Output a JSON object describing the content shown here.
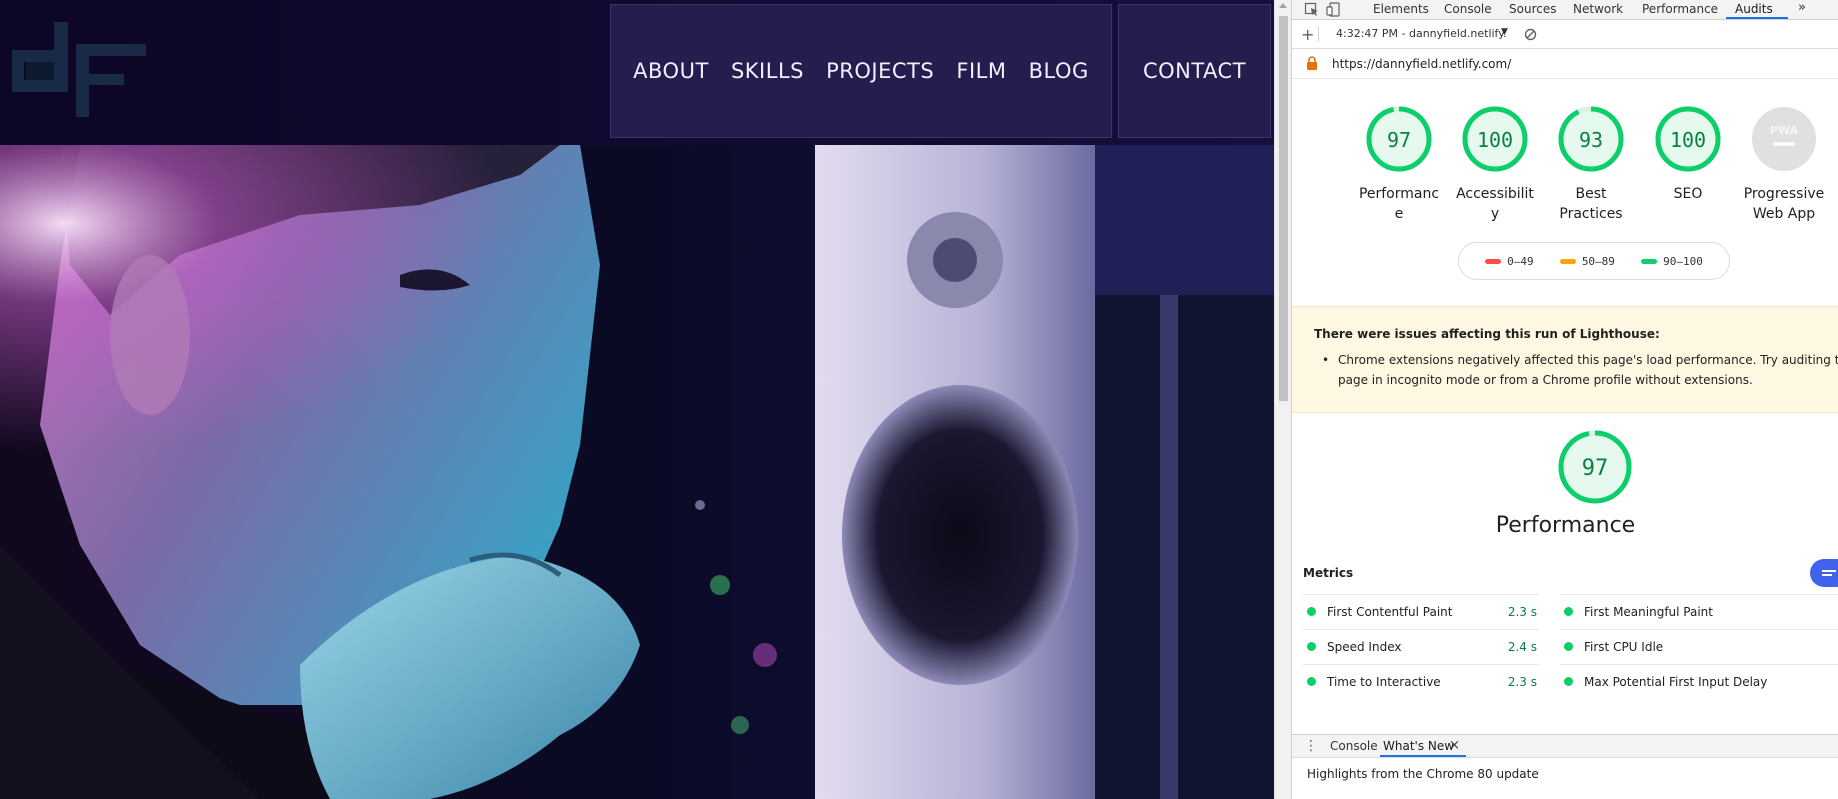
{
  "site": {
    "nav": {
      "about": "ABOUT",
      "skills": "SKILLS",
      "projects": "PROJECTS",
      "film": "FILM",
      "blog": "BLOG",
      "contact": "CONTACT"
    },
    "colors": {
      "header_bg": "#120a32",
      "nav_bg": "#241d4d",
      "nav_text": "#f2f0ff"
    }
  },
  "devtools": {
    "tabs": [
      "Elements",
      "Console",
      "Sources",
      "Network",
      "Performance",
      "Audits"
    ],
    "active_tab": "Audits",
    "more_tabs_icon": "double-chevron-right-icon",
    "report_selector": "4:32:47 PM - dannyfield.netlify.",
    "url": "https://dannyfield.netlify.com/",
    "categories": [
      {
        "score": "97",
        "label": "Performance",
        "value": 97
      },
      {
        "score": "100",
        "label": "Accessibility",
        "value": 100
      },
      {
        "score": "93",
        "label": "Best Practices",
        "value": 93
      },
      {
        "score": "100",
        "label": "SEO",
        "value": 100
      },
      {
        "score": "PWA",
        "label": "Progressive Web App",
        "value": null
      }
    ],
    "legend": [
      {
        "range": "0–49",
        "color": "#ff4e42"
      },
      {
        "range": "50–89",
        "color": "#ffa400"
      },
      {
        "range": "90–100",
        "color": "#0cce6b"
      }
    ],
    "warning": {
      "title": "There were issues affecting this run of Lighthouse:",
      "items": [
        "Chrome extensions negatively affected this page's load performance. Try auditing the page in incognito mode or from a Chrome profile without extensions."
      ]
    },
    "performance": {
      "score": "97",
      "value": 97,
      "title": "Performance",
      "metrics_heading": "Metrics",
      "metrics_left": [
        {
          "name": "First Contentful Paint",
          "value": "2.3 s"
        },
        {
          "name": "Speed Index",
          "value": "2.4 s"
        },
        {
          "name": "Time to Interactive",
          "value": "2.3 s"
        }
      ],
      "metrics_right": [
        {
          "name": "First Meaningful Paint"
        },
        {
          "name": "First CPU Idle"
        },
        {
          "name": "Max Potential First Input Delay"
        }
      ]
    },
    "drawer": {
      "tabs": [
        "Console",
        "What's New"
      ],
      "active_tab": "What's New",
      "close_glyph": "×",
      "content": "Highlights from the Chrome 80 update"
    },
    "colors": {
      "pass": "#0cce6b",
      "pass_text": "#0b8043",
      "accent": "#1a73e8",
      "warning_bg": "#fef8e3"
    }
  }
}
